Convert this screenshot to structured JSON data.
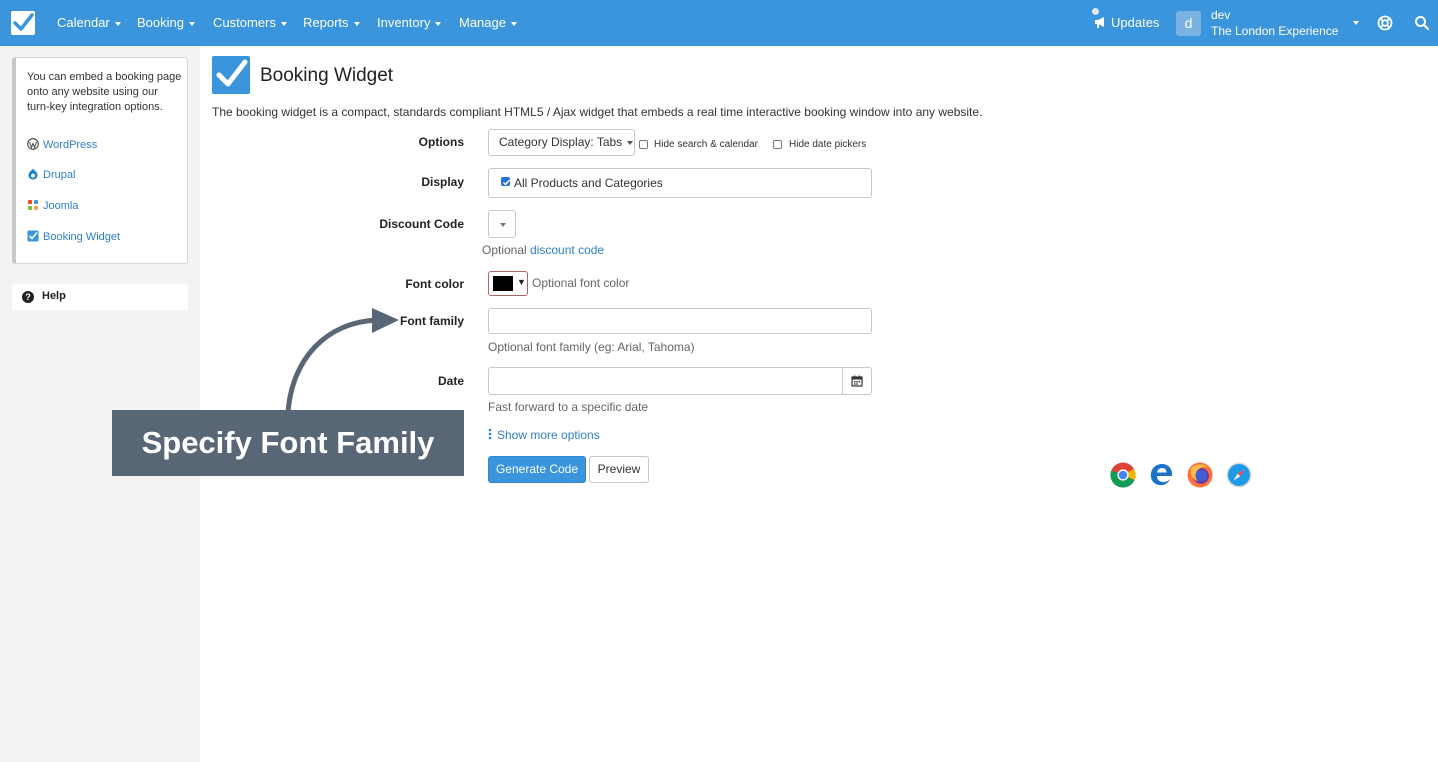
{
  "nav": {
    "items": [
      {
        "label": "Calendar"
      },
      {
        "label": "Booking"
      },
      {
        "label": "Customers"
      },
      {
        "label": "Reports"
      },
      {
        "label": "Inventory"
      },
      {
        "label": "Manage"
      }
    ],
    "updates_label": "Updates",
    "user_initial": "d",
    "user_name": "dev",
    "user_company": "The London Experience",
    "bar_color": "#3a95dd"
  },
  "sidebar": {
    "intro": "You can embed a booking page onto any website using our turn-key integration options.",
    "links": [
      {
        "label": "WordPress",
        "icon": "wordpress-icon"
      },
      {
        "label": "Drupal",
        "icon": "drupal-icon"
      },
      {
        "label": "Joomla",
        "icon": "joomla-icon"
      },
      {
        "label": "Booking Widget",
        "icon": "booking-widget-icon"
      }
    ],
    "help_label": "Help"
  },
  "page": {
    "title": "Booking Widget",
    "description": "The booking widget is a compact, standards compliant HTML5 / Ajax widget that embeds a real time interactive booking window into any website."
  },
  "form": {
    "options": {
      "label": "Options",
      "category_display": "Category Display: Tabs",
      "hide_search": "Hide search & calendar",
      "hide_search_checked": false,
      "hide_date": "Hide date pickers",
      "hide_date_checked": false
    },
    "display": {
      "label": "Display",
      "value": "All Products and Categories",
      "checked": true
    },
    "discount": {
      "label": "Discount Code",
      "help_prefix": "Optional",
      "help_link": "discount code"
    },
    "font_color": {
      "label": "Font color",
      "value": "#000000",
      "help": "Optional font color"
    },
    "font_family": {
      "label": "Font family",
      "value": "",
      "help": "Optional font family (eg: Arial, Tahoma)"
    },
    "date": {
      "label": "Date",
      "value": "",
      "help": "Fast forward to a specific date"
    },
    "show_more": "Show more options",
    "generate_label": "Generate Code",
    "preview_label": "Preview"
  },
  "browsers": [
    "chrome-icon",
    "edge-icon",
    "firefox-icon",
    "safari-icon"
  ],
  "callout": {
    "text": "Specify Font Family",
    "color": "#586675"
  }
}
